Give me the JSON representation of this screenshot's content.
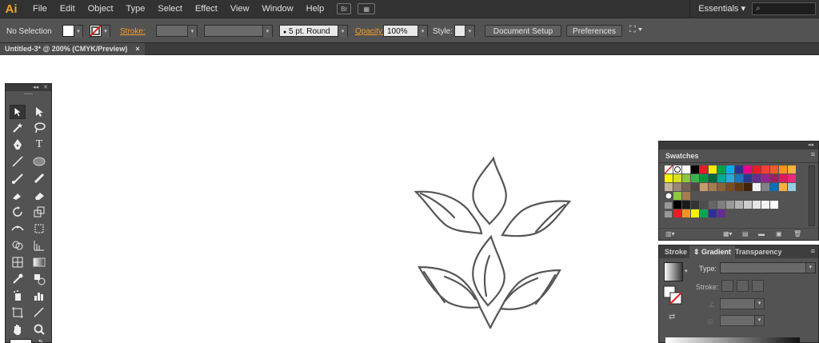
{
  "app": {
    "logo": "Ai",
    "essentials": "Essentials",
    "bridge_label": "Br"
  },
  "menu": [
    "File",
    "Edit",
    "Object",
    "Type",
    "Select",
    "Effect",
    "View",
    "Window",
    "Help"
  ],
  "control_bar": {
    "selection_label": "No Selection",
    "stroke_label": "Stroke:",
    "brush_value": "5 pt. Round",
    "opacity_label": "Opacity:",
    "opacity_value": "100%",
    "style_label": "Style:",
    "document_setup": "Document Setup",
    "preferences": "Preferences"
  },
  "document_tab": {
    "title": "Untitled-3* @ 200% (CMYK/Preview)",
    "close": "×"
  },
  "swatches_panel": {
    "title": "Swatches",
    "accent": "#f7a21b"
  },
  "gradient_panel": {
    "tabs": [
      "Stroke",
      "Gradient",
      "Transparency"
    ],
    "type_label": "Type:",
    "stroke_label": "Stroke:"
  }
}
